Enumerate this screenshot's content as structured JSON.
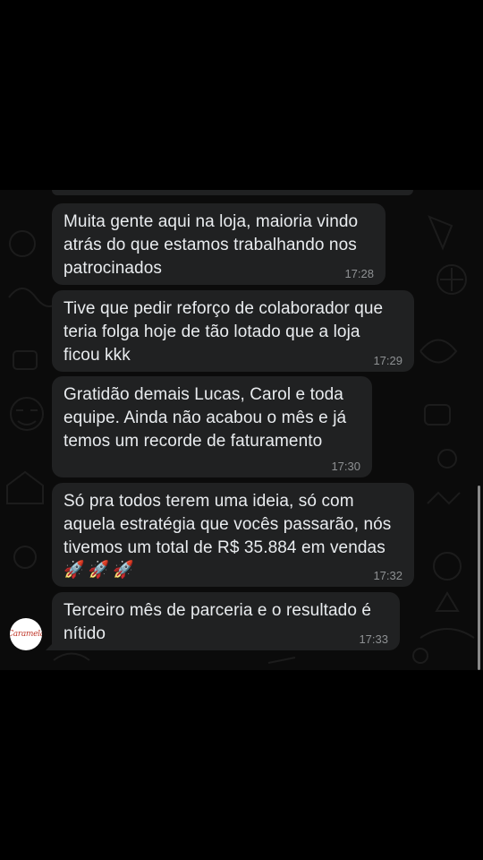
{
  "messages": [
    {
      "text": "Muita gente aqui na loja, maioria vindo\natrás do que estamos trabalhando nos\npatrocinados",
      "time": "17:28"
    },
    {
      "text": "Tive que pedir reforço de colaborador que\nteria folga hoje de tão lotado que a loja\nficou kkk",
      "time": "17:29"
    },
    {
      "text": "Gratidão demais Lucas, Carol e toda\nequipe. Ainda não acabou o mês e já\ntemos um recorde de faturamento",
      "time": "17:30"
    },
    {
      "text": "Só pra todos terem uma ideia, só com\naquela estratégia que vocês passarão, nós\ntivemos um total de R$ 35.884 em vendas",
      "emoji": "🚀🚀🚀",
      "time": "17:32"
    },
    {
      "text": "Terceiro mês de parceria e o resultado é\nnítido",
      "time": "17:33"
    }
  ],
  "avatar": {
    "label": "Caramela",
    "icon": "brand-logo",
    "color": "#c0392b"
  },
  "colors": {
    "bubble": "#202122",
    "text": "#e9ecef",
    "time": "#8e9193",
    "background": "#0b0b0b"
  }
}
